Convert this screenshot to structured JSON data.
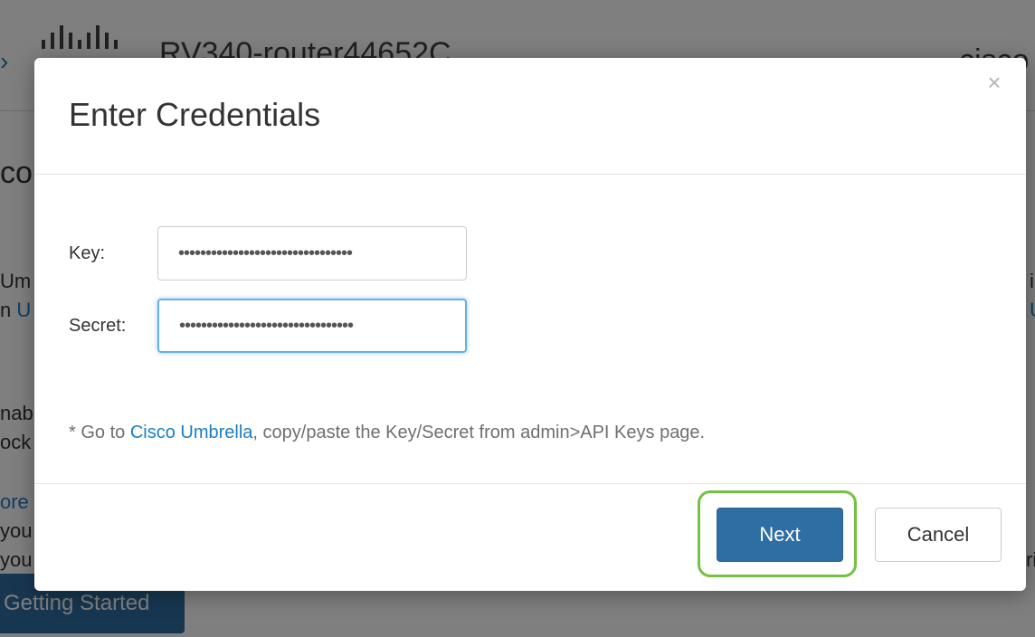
{
  "background": {
    "header": {
      "router_name": "RV340-router44652C",
      "brand": "cisco"
    },
    "fragments": {
      "heading": "co",
      "line1": "Um",
      "line2_prefix": "n ",
      "line2_link": "U",
      "line3": "nab",
      "line4": "ock",
      "line5": "ore",
      "line6": "you",
      "line7": "you",
      "right1": "i",
      "right2": "U",
      "right3": "ri"
    },
    "getting_started_button": "Getting Started"
  },
  "dialog": {
    "title": "Enter Credentials",
    "close_glyph": "×",
    "key": {
      "label": "Key:",
      "value": "••••••••••••••••••••••••••••••••"
    },
    "secret": {
      "label": "Secret:",
      "value": "••••••••••••••••••••••••••••••••"
    },
    "help": {
      "prefix": "* Go to ",
      "link": "Cisco Umbrella",
      "suffix": ", copy/paste the Key/Secret from admin>API Keys page."
    },
    "buttons": {
      "next": "Next",
      "cancel": "Cancel"
    }
  },
  "colors": {
    "primary": "#2f6ea3",
    "link": "#1a7ec6",
    "highlight": "#78c043",
    "focus": "#66afe9"
  }
}
